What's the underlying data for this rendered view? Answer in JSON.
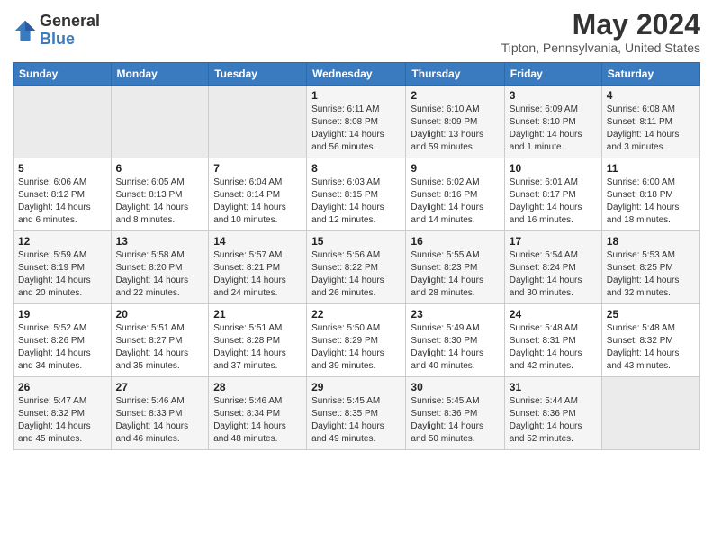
{
  "header": {
    "logo_general": "General",
    "logo_blue": "Blue",
    "month_title": "May 2024",
    "location": "Tipton, Pennsylvania, United States"
  },
  "weekdays": [
    "Sunday",
    "Monday",
    "Tuesday",
    "Wednesday",
    "Thursday",
    "Friday",
    "Saturday"
  ],
  "weeks": [
    [
      {
        "day": "",
        "sunrise": "",
        "sunset": "",
        "daylight": ""
      },
      {
        "day": "",
        "sunrise": "",
        "sunset": "",
        "daylight": ""
      },
      {
        "day": "",
        "sunrise": "",
        "sunset": "",
        "daylight": ""
      },
      {
        "day": "1",
        "sunrise": "Sunrise: 6:11 AM",
        "sunset": "Sunset: 8:08 PM",
        "daylight": "Daylight: 14 hours and 56 minutes."
      },
      {
        "day": "2",
        "sunrise": "Sunrise: 6:10 AM",
        "sunset": "Sunset: 8:09 PM",
        "daylight": "Daylight: 13 hours and 59 minutes."
      },
      {
        "day": "3",
        "sunrise": "Sunrise: 6:09 AM",
        "sunset": "Sunset: 8:10 PM",
        "daylight": "Daylight: 14 hours and 1 minute."
      },
      {
        "day": "4",
        "sunrise": "Sunrise: 6:08 AM",
        "sunset": "Sunset: 8:11 PM",
        "daylight": "Daylight: 14 hours and 3 minutes."
      }
    ],
    [
      {
        "day": "5",
        "sunrise": "Sunrise: 6:06 AM",
        "sunset": "Sunset: 8:12 PM",
        "daylight": "Daylight: 14 hours and 6 minutes."
      },
      {
        "day": "6",
        "sunrise": "Sunrise: 6:05 AM",
        "sunset": "Sunset: 8:13 PM",
        "daylight": "Daylight: 14 hours and 8 minutes."
      },
      {
        "day": "7",
        "sunrise": "Sunrise: 6:04 AM",
        "sunset": "Sunset: 8:14 PM",
        "daylight": "Daylight: 14 hours and 10 minutes."
      },
      {
        "day": "8",
        "sunrise": "Sunrise: 6:03 AM",
        "sunset": "Sunset: 8:15 PM",
        "daylight": "Daylight: 14 hours and 12 minutes."
      },
      {
        "day": "9",
        "sunrise": "Sunrise: 6:02 AM",
        "sunset": "Sunset: 8:16 PM",
        "daylight": "Daylight: 14 hours and 14 minutes."
      },
      {
        "day": "10",
        "sunrise": "Sunrise: 6:01 AM",
        "sunset": "Sunset: 8:17 PM",
        "daylight": "Daylight: 14 hours and 16 minutes."
      },
      {
        "day": "11",
        "sunrise": "Sunrise: 6:00 AM",
        "sunset": "Sunset: 8:18 PM",
        "daylight": "Daylight: 14 hours and 18 minutes."
      }
    ],
    [
      {
        "day": "12",
        "sunrise": "Sunrise: 5:59 AM",
        "sunset": "Sunset: 8:19 PM",
        "daylight": "Daylight: 14 hours and 20 minutes."
      },
      {
        "day": "13",
        "sunrise": "Sunrise: 5:58 AM",
        "sunset": "Sunset: 8:20 PM",
        "daylight": "Daylight: 14 hours and 22 minutes."
      },
      {
        "day": "14",
        "sunrise": "Sunrise: 5:57 AM",
        "sunset": "Sunset: 8:21 PM",
        "daylight": "Daylight: 14 hours and 24 minutes."
      },
      {
        "day": "15",
        "sunrise": "Sunrise: 5:56 AM",
        "sunset": "Sunset: 8:22 PM",
        "daylight": "Daylight: 14 hours and 26 minutes."
      },
      {
        "day": "16",
        "sunrise": "Sunrise: 5:55 AM",
        "sunset": "Sunset: 8:23 PM",
        "daylight": "Daylight: 14 hours and 28 minutes."
      },
      {
        "day": "17",
        "sunrise": "Sunrise: 5:54 AM",
        "sunset": "Sunset: 8:24 PM",
        "daylight": "Daylight: 14 hours and 30 minutes."
      },
      {
        "day": "18",
        "sunrise": "Sunrise: 5:53 AM",
        "sunset": "Sunset: 8:25 PM",
        "daylight": "Daylight: 14 hours and 32 minutes."
      }
    ],
    [
      {
        "day": "19",
        "sunrise": "Sunrise: 5:52 AM",
        "sunset": "Sunset: 8:26 PM",
        "daylight": "Daylight: 14 hours and 34 minutes."
      },
      {
        "day": "20",
        "sunrise": "Sunrise: 5:51 AM",
        "sunset": "Sunset: 8:27 PM",
        "daylight": "Daylight: 14 hours and 35 minutes."
      },
      {
        "day": "21",
        "sunrise": "Sunrise: 5:51 AM",
        "sunset": "Sunset: 8:28 PM",
        "daylight": "Daylight: 14 hours and 37 minutes."
      },
      {
        "day": "22",
        "sunrise": "Sunrise: 5:50 AM",
        "sunset": "Sunset: 8:29 PM",
        "daylight": "Daylight: 14 hours and 39 minutes."
      },
      {
        "day": "23",
        "sunrise": "Sunrise: 5:49 AM",
        "sunset": "Sunset: 8:30 PM",
        "daylight": "Daylight: 14 hours and 40 minutes."
      },
      {
        "day": "24",
        "sunrise": "Sunrise: 5:48 AM",
        "sunset": "Sunset: 8:31 PM",
        "daylight": "Daylight: 14 hours and 42 minutes."
      },
      {
        "day": "25",
        "sunrise": "Sunrise: 5:48 AM",
        "sunset": "Sunset: 8:32 PM",
        "daylight": "Daylight: 14 hours and 43 minutes."
      }
    ],
    [
      {
        "day": "26",
        "sunrise": "Sunrise: 5:47 AM",
        "sunset": "Sunset: 8:32 PM",
        "daylight": "Daylight: 14 hours and 45 minutes."
      },
      {
        "day": "27",
        "sunrise": "Sunrise: 5:46 AM",
        "sunset": "Sunset: 8:33 PM",
        "daylight": "Daylight: 14 hours and 46 minutes."
      },
      {
        "day": "28",
        "sunrise": "Sunrise: 5:46 AM",
        "sunset": "Sunset: 8:34 PM",
        "daylight": "Daylight: 14 hours and 48 minutes."
      },
      {
        "day": "29",
        "sunrise": "Sunrise: 5:45 AM",
        "sunset": "Sunset: 8:35 PM",
        "daylight": "Daylight: 14 hours and 49 minutes."
      },
      {
        "day": "30",
        "sunrise": "Sunrise: 5:45 AM",
        "sunset": "Sunset: 8:36 PM",
        "daylight": "Daylight: 14 hours and 50 minutes."
      },
      {
        "day": "31",
        "sunrise": "Sunrise: 5:44 AM",
        "sunset": "Sunset: 8:36 PM",
        "daylight": "Daylight: 14 hours and 52 minutes."
      },
      {
        "day": "",
        "sunrise": "",
        "sunset": "",
        "daylight": ""
      }
    ]
  ]
}
